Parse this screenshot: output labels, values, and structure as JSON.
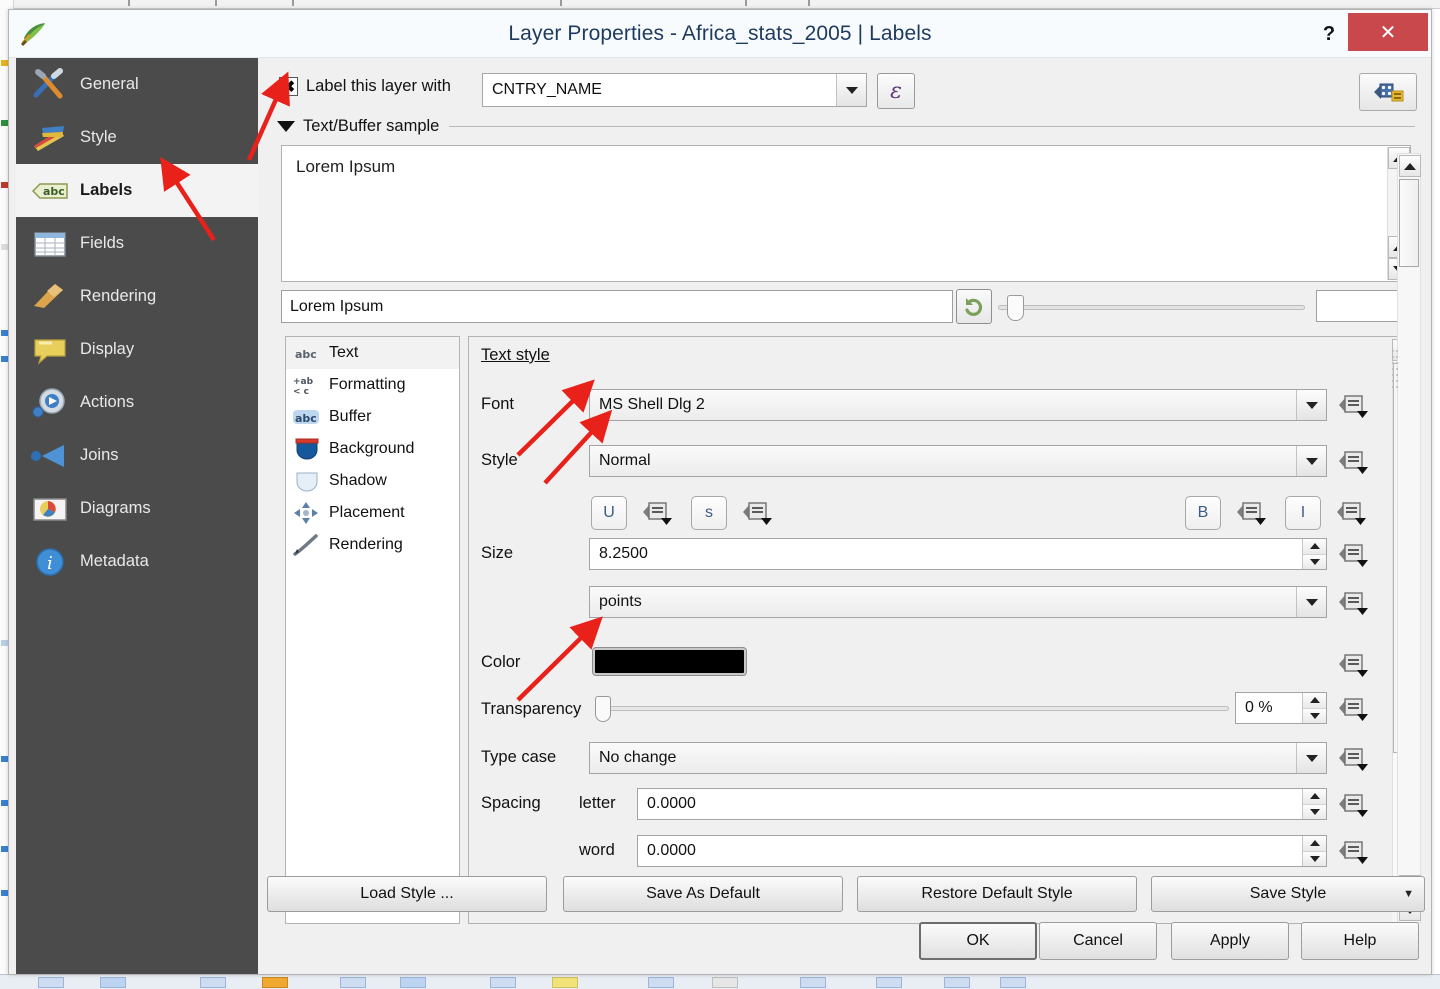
{
  "window": {
    "title": "Layer Properties - Africa_stats_2005 | Labels",
    "app_icon": "qgis-icon",
    "help_label": "?",
    "close_label": "✕"
  },
  "sidebar": {
    "items": [
      {
        "label": "General",
        "icon": "tools-icon",
        "active": false
      },
      {
        "label": "Style",
        "icon": "paintbrush-icon",
        "active": false
      },
      {
        "label": "Labels",
        "icon": "abc-label-icon",
        "active": true
      },
      {
        "label": "Fields",
        "icon": "table-icon",
        "active": false
      },
      {
        "label": "Rendering",
        "icon": "broom-icon",
        "active": false
      },
      {
        "label": "Display",
        "icon": "speech-bubble-icon",
        "active": false
      },
      {
        "label": "Actions",
        "icon": "gear-play-icon",
        "active": false
      },
      {
        "label": "Joins",
        "icon": "join-arrow-icon",
        "active": false
      },
      {
        "label": "Diagrams",
        "icon": "pie-chart-icon",
        "active": false
      },
      {
        "label": "Metadata",
        "icon": "info-icon",
        "active": false
      }
    ]
  },
  "top": {
    "checkbox_label": "Label this layer with",
    "checkbox_mark": "✖",
    "checkbox_checked": true,
    "field_value": "CNTRY_NAME",
    "expression_button": "ε",
    "datadefined_button": "data-defined-override"
  },
  "sample": {
    "section_title": "Text/Buffer sample",
    "preview_text": "Lorem Ipsum",
    "input_value": "Lorem Ipsum",
    "reset_button": "revert-icon",
    "zoom_value": ""
  },
  "categories": [
    {
      "label": "Text",
      "icon": "abc-icon",
      "selected": true
    },
    {
      "label": "Formatting",
      "icon": "formatting-icon",
      "selected": false
    },
    {
      "label": "Buffer",
      "icon": "abc-buffer-icon",
      "selected": false
    },
    {
      "label": "Background",
      "icon": "shield-blue-icon",
      "selected": false
    },
    {
      "label": "Shadow",
      "icon": "shield-pale-icon",
      "selected": false
    },
    {
      "label": "Placement",
      "icon": "move-arrows-icon",
      "selected": false
    },
    {
      "label": "Rendering",
      "icon": "brush-icon",
      "selected": false
    }
  ],
  "text_style": {
    "heading": "Text style",
    "font": {
      "label": "Font",
      "value": "MS Shell Dlg 2"
    },
    "style": {
      "label": "Style",
      "value": "Normal"
    },
    "toggles": {
      "underline": "U",
      "strikethrough": "s",
      "bold": "B",
      "italic": "I"
    },
    "size": {
      "label": "Size",
      "value": "8.2500"
    },
    "units": {
      "value": "points"
    },
    "color": {
      "label": "Color",
      "value": "#000000"
    },
    "transparency": {
      "label": "Transparency",
      "value": "0 %"
    },
    "type_case": {
      "label": "Type case",
      "value": "No change"
    },
    "spacing": {
      "label": "Spacing",
      "letter_label": "letter",
      "letter_value": "0.0000",
      "word_label": "word",
      "word_value": "0.0000"
    }
  },
  "footer": {
    "style_buttons": [
      {
        "label": "Load Style ..."
      },
      {
        "label": "Save As Default"
      },
      {
        "label": "Restore Default Style"
      },
      {
        "label": "Save Style",
        "has_dropdown": true
      }
    ],
    "dialog_buttons": [
      {
        "label": "OK",
        "default": true
      },
      {
        "label": "Cancel",
        "default": false
      },
      {
        "label": "Apply",
        "default": false
      },
      {
        "label": "Help",
        "default": false
      }
    ]
  },
  "colors": {
    "sidebar_bg": "#4b4b4b",
    "titlebar_bg": "#f8fbfd",
    "close_red": "#c8484c",
    "annotation_red": "#e8211b",
    "title_text": "#1f3a5f"
  }
}
